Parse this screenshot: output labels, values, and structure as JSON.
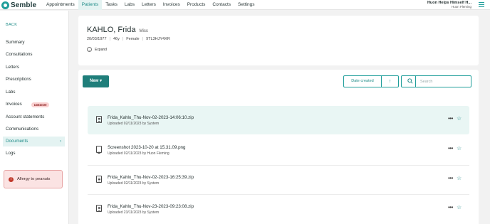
{
  "app": {
    "logo_text": "Semble"
  },
  "nav": {
    "items": [
      {
        "label": "Appointments",
        "active": false
      },
      {
        "label": "Patients",
        "active": true
      },
      {
        "label": "Tasks",
        "active": false
      },
      {
        "label": "Labs",
        "active": false
      },
      {
        "label": "Letters",
        "active": false
      },
      {
        "label": "Invoices",
        "active": false
      },
      {
        "label": "Products",
        "active": false
      },
      {
        "label": "Contacts",
        "active": false
      },
      {
        "label": "Settings",
        "active": false
      }
    ]
  },
  "user": {
    "practice": "Huon Helps Himself H...",
    "name": "Huon Fleming"
  },
  "sidebar": {
    "back": "BACK",
    "items": [
      {
        "label": "Summary"
      },
      {
        "label": "Consultations"
      },
      {
        "label": "Letters"
      },
      {
        "label": "Prescriptions"
      },
      {
        "label": "Labs"
      },
      {
        "label": "Invoices",
        "badge": "£4610.00"
      },
      {
        "label": "Account statements"
      },
      {
        "label": "Communications"
      },
      {
        "label": "Documents",
        "active": true,
        "chevron": "›"
      },
      {
        "label": "Logs"
      }
    ],
    "allergy": {
      "icon": "!",
      "text": "Allergy to peanuts"
    }
  },
  "patient": {
    "name": "KAHLO, Frida",
    "title": "Miss",
    "dob": "20/03/1977",
    "age": "46y",
    "sex": "Female",
    "id": "9TL3HJY4XR",
    "expand": "Expand"
  },
  "documents": {
    "new_label": "New",
    "sort_label": "Date created",
    "sort_dir_icon": "↑",
    "search_placeholder": "Search",
    "more_glyph": "•••",
    "star_glyph": "☆",
    "items": [
      {
        "name": "Frida_Kahlo_Thu-Nov-02-2023-14:06:10.zip",
        "uploaded": "Uploaded 02/11/2023 by System",
        "type": "file"
      },
      {
        "name": "Screenshot 2023-10-20 at 15.31.09.png",
        "uploaded": "Uploaded 02/11/2023 by Huon Fleming",
        "type": "image"
      },
      {
        "name": "Frida_Kahlo_Thu-Nov-02-2023-16:25:39.zip",
        "uploaded": "Uploaded 02/11/2023 by System",
        "type": "file"
      },
      {
        "name": "Frida_Kahlo_Thu-Nov-23-2023-09:23:08.zip",
        "uploaded": "Uploaded 23/11/2023 by System",
        "type": "file"
      }
    ]
  },
  "colors": {
    "accent": "#1f9e9a",
    "accent_dark": "#1f7e7a",
    "alert_bg": "#fbe3e3",
    "badge_bg": "#f9d0d0"
  }
}
